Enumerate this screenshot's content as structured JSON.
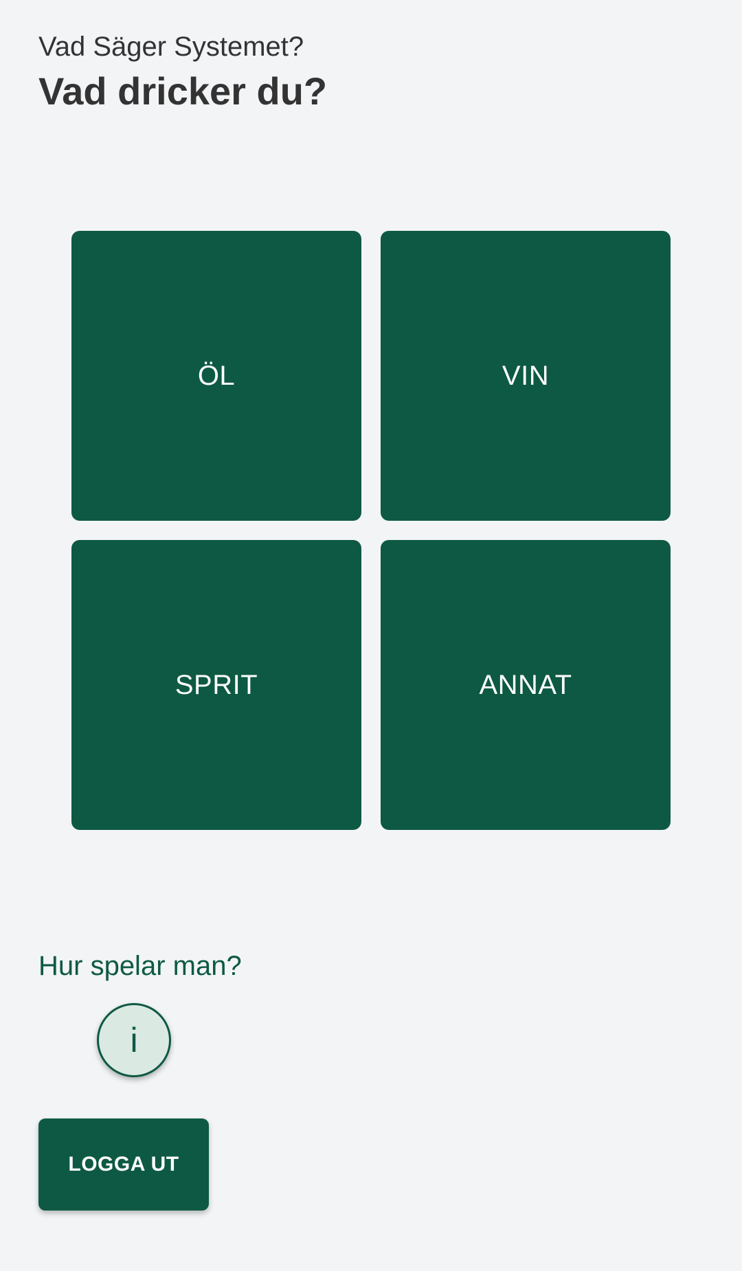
{
  "header": {
    "app_name": "Vad Säger Systemet?",
    "title": "Vad dricker du?"
  },
  "categories": [
    {
      "label": "ÖL"
    },
    {
      "label": "VIN"
    },
    {
      "label": "SPRIT"
    },
    {
      "label": "ANNAT"
    }
  ],
  "help": {
    "link_label": "Hur spelar man?",
    "info_glyph": "i",
    "info_icon": "info-icon"
  },
  "actions": {
    "logout_label": "LOGGA UT"
  },
  "colors": {
    "primary": "#0e5943",
    "background": "#f2f4f6",
    "text": "#333333",
    "info_fill": "#dbe9e3"
  }
}
